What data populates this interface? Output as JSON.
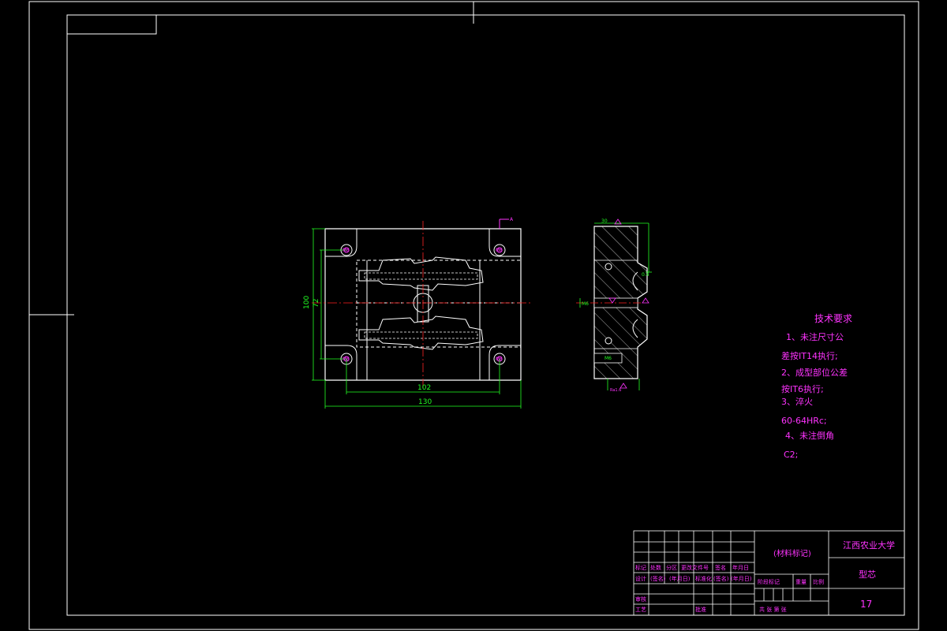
{
  "main_view": {
    "dim_height_outer": "100",
    "dim_height_inner": "72",
    "dim_width_inner": "102",
    "dim_width_outer": "130",
    "hole_label": "M6",
    "section_mark": "A"
  },
  "side_view": {
    "dim_top": "30",
    "dim_small": "0.4",
    "dim_hole": "M6",
    "dim_bottom": "M6",
    "roughness_label": "Ra1.6"
  },
  "tech_requirements": {
    "title": "技术要求",
    "lines": [
      "1、未注尺寸公",
      "差按IT14执行;",
      "2、成型部位公差",
      "按IT6执行;",
      "3、淬火",
      "60-64HRc;",
      "4、未注倒角",
      "C2;"
    ]
  },
  "title_block": {
    "material_mark": "(材料标记)",
    "school": "江西农业大学",
    "part_name": "型芯",
    "sheet_number": "17",
    "row_labels": [
      "标记",
      "处数",
      "分区",
      "更改文件号",
      "签名",
      "年月日"
    ],
    "design_row": [
      "设计",
      "(签名)",
      "(年月日)",
      "标准化",
      "(签名)",
      "(年月日)"
    ],
    "stage_labels": [
      "阶段标记",
      "重量",
      "比例"
    ],
    "review_label": "审核",
    "process_label": "工艺",
    "approve_label": "批准",
    "sheets_label": "共  张 第  张"
  }
}
